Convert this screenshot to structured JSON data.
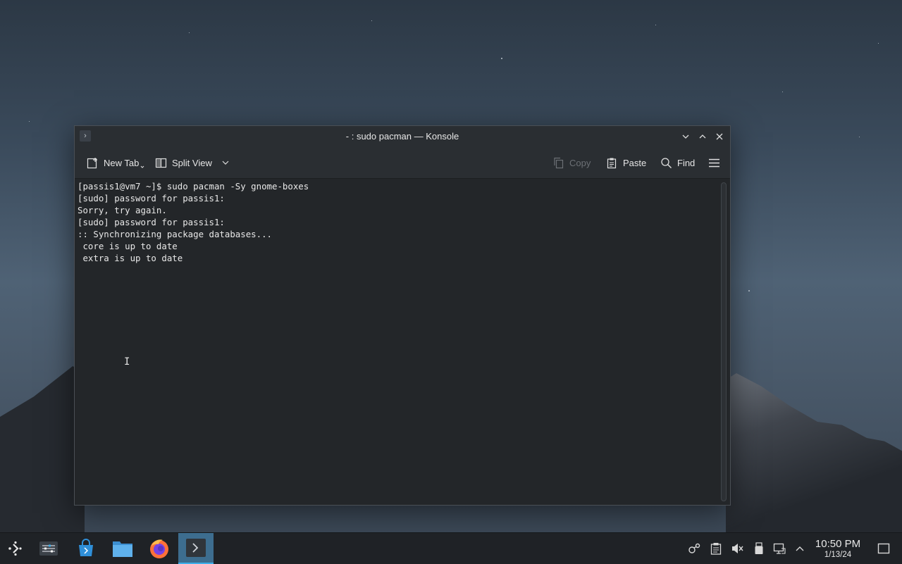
{
  "window": {
    "title": "- : sudo pacman — Konsole"
  },
  "toolbar": {
    "new_tab_label": "New Tab",
    "split_view_label": "Split View",
    "copy_label": "Copy",
    "paste_label": "Paste",
    "find_label": "Find"
  },
  "terminal": {
    "lines": [
      "[passis1@vm7 ~]$ sudo pacman -Sy gnome-boxes",
      "[sudo] password for passis1:",
      "Sorry, try again.",
      "[sudo] password for passis1:",
      ":: Synchronizing package databases...",
      " core is up to date",
      " extra is up to date"
    ]
  },
  "taskbar": {
    "apps": [
      "application-launcher-icon",
      "system-settings-icon",
      "discover-store-icon",
      "file-manager-icon",
      "firefox-icon",
      "konsole-icon"
    ],
    "tray_icons": [
      "network-icon",
      "clipboard-icon",
      "volume-muted-icon",
      "usb-device-icon",
      "display-icon",
      "chevron-up-icon"
    ],
    "clock": {
      "time": "10:50 PM",
      "date": "1/13/24"
    }
  },
  "colors": {
    "accent": "#3daee9",
    "window_bg": "#232629",
    "taskbar_bg": "#1f2226"
  }
}
